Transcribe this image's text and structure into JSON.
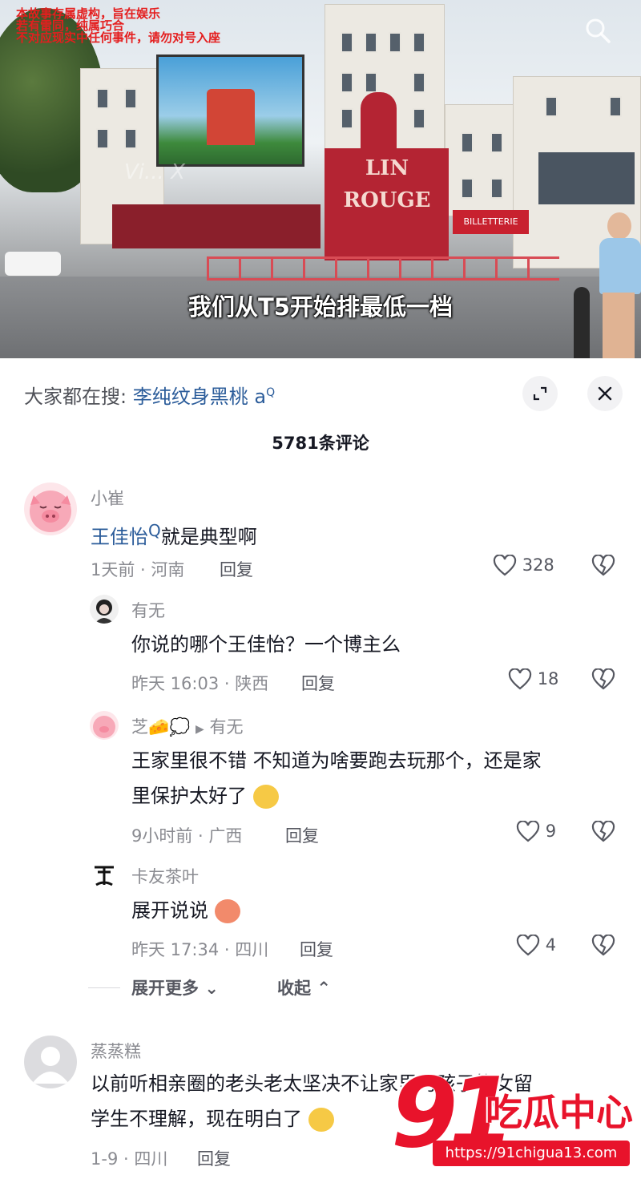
{
  "video": {
    "disclaimer": [
      "本故事存属虚构，旨在娱乐",
      "若有雷同，纯属巧合",
      "不对应现实中任何事件，请勿对号入座"
    ],
    "subtitle": "我们从T5开始排最低一档",
    "watermark": "Vi... X",
    "sign_text": "LIN ROUGE",
    "billetterie": "BILLETTERIE"
  },
  "panel": {
    "hot_search_prefix": "大家都在搜:",
    "hot_search_keyword": "李纯纹身黑桃 a",
    "comment_count": "5781条评论"
  },
  "comments": [
    {
      "name": "小崔",
      "text_link": "王佳怡",
      "text": "就是典型啊",
      "meta": "1天前 · 河南",
      "reply": "回复",
      "likes": "328"
    },
    {
      "name": "有无",
      "text": "你说的哪个王佳怡？一个博主么",
      "meta": "昨天 16:03 · 陕西",
      "reply": "回复",
      "likes": "18"
    },
    {
      "name": "芝🧀💭",
      "reply_to": "有无",
      "text": "王家里很不错 不知道为啥要跑去玩那个，还是家",
      "text2": "里保护太好了",
      "meta": "9小时前 · 广西",
      "reply": "回复",
      "likes": "9"
    },
    {
      "name": "卡友茶叶",
      "text": "展开说说",
      "meta": "昨天 17:34 · 四川",
      "reply": "回复",
      "likes": "4"
    },
    {
      "name": "蒸蒸糕",
      "text": "以前听相亲圈的老头老太坚决不让家里男孩子找女留",
      "text2": "学生不理解，现在明白了",
      "meta": "1-9 · 四川",
      "reply": "回复"
    }
  ],
  "thread": {
    "more": "展开更多",
    "collapse": "收起"
  },
  "site_logo": {
    "number": "91",
    "cn": "吃瓜中心",
    "url": "https://91chigua13.com"
  }
}
